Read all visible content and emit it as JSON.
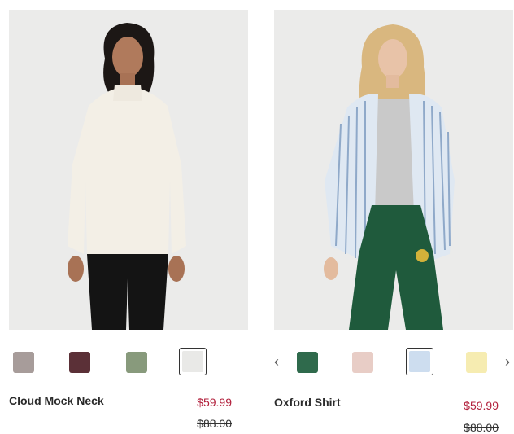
{
  "products": [
    {
      "name": "Cloud Mock Neck",
      "sale_price": "$59.99",
      "original_price": "$88.00",
      "swatches": [
        {
          "color": "#a79c9a",
          "selected": false
        },
        {
          "color": "#5b3037",
          "selected": false
        },
        {
          "color": "#889a7c",
          "selected": false
        },
        {
          "color": "#e9e9e7",
          "selected": true
        }
      ]
    },
    {
      "name": "Oxford Shirt",
      "sale_price": "$59.99",
      "original_price": "$88.00",
      "prev_icon": "chevron-left-icon",
      "next_icon": "chevron-right-icon",
      "swatches": [
        {
          "color": "#2f6a4c",
          "selected": false
        },
        {
          "color": "#e8cdc6",
          "selected": false
        },
        {
          "color": "#cdddef",
          "selected": true
        },
        {
          "color": "#f6ecb1",
          "selected": false
        }
      ]
    }
  ],
  "glyphs": {
    "prev": "‹",
    "next": "›"
  }
}
